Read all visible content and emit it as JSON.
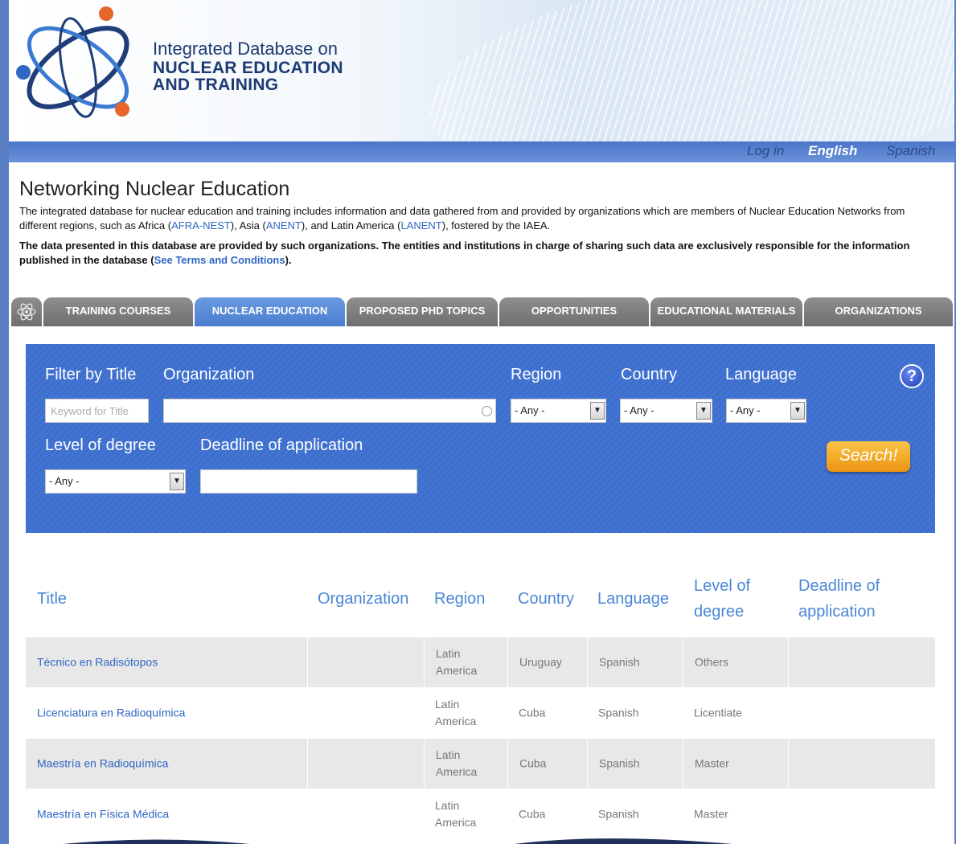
{
  "header": {
    "site_title_line1": "Integrated Database on",
    "site_title_line2": "NUCLEAR EDUCATION",
    "site_title_line3": "AND TRAINING"
  },
  "nav": {
    "login": "Log in",
    "english": "English",
    "spanish": "Spanish"
  },
  "intro": {
    "title": "Networking Nuclear Education",
    "p1_a": "The integrated database for nuclear education and training includes information and data gathered from and provided by organizations which are members of Nuclear Education Networks from different regions, such as Africa (",
    "afra": "AFRA-NEST",
    "p1_b": "), Asia (",
    "anent": "ANENT",
    "p1_c": "), and Latin America (",
    "lanent": "LANENT",
    "p1_d": "), fostered by the IAEA.",
    "p2_a": "The data presented in this database are provided by such organizations. The entities and institutions in charge of sharing such data are exclusively responsible for the information published in the database (",
    "terms": "See Terms and Conditions",
    "p2_b": ")."
  },
  "tabs": [
    {
      "label": "TRAINING COURSES"
    },
    {
      "label": "NUCLEAR EDUCATION"
    },
    {
      "label": "PROPOSED PHD TOPICS"
    },
    {
      "label": "OPPORTUNITIES"
    },
    {
      "label": "EDUCATIONAL MATERIALS"
    },
    {
      "label": "ORGANIZATIONS"
    }
  ],
  "filters": {
    "title_label": "Filter by Title",
    "title_placeholder": "Keyword for Title",
    "organization_label": "Organization",
    "region_label": "Region",
    "region_value": "- Any -",
    "country_label": "Country",
    "country_value": "- Any -",
    "language_label": "Language",
    "language_value": "- Any -",
    "degree_label": "Level of degree",
    "degree_value": "- Any -",
    "deadline_label": "Deadline of application",
    "help": "?",
    "search_label": "Search!"
  },
  "table": {
    "headers": {
      "title": "Title",
      "organization": "Organization",
      "region": "Region",
      "country": "Country",
      "language": "Language",
      "level_l1": "Level of",
      "level_l2": "degree",
      "deadline_l1": "Deadline of",
      "deadline_l2": "application"
    },
    "rows": [
      {
        "title": "Técnico en Radisótopos",
        "organization": "",
        "region_l1": "Latin",
        "region_l2": "America",
        "country": "Uruguay",
        "language": "Spanish",
        "level": "Others",
        "deadline": ""
      },
      {
        "title": "Licenciatura en Radioquímica",
        "organization": "",
        "region_l1": "Latin",
        "region_l2": "America",
        "country": "Cuba",
        "language": "Spanish",
        "level": "Licentiate",
        "deadline": ""
      },
      {
        "title": "Maestría en Radioquímica",
        "organization": "",
        "region_l1": "Latin",
        "region_l2": "America",
        "country": "Cuba",
        "language": "Spanish",
        "level": "Master",
        "deadline": ""
      },
      {
        "title": "Maestría en Física Médica",
        "organization": "",
        "region_l1": "Latin",
        "region_l2": "America",
        "country": "Cuba",
        "language": "Spanish",
        "level": "Master",
        "deadline": ""
      }
    ]
  },
  "colors": {
    "brand_blue": "#3d6fcf",
    "link_blue": "#2f67c3",
    "header_blue": "#4a86d6",
    "search_orange": "#f2a51c",
    "logo_orange": "#e8662a"
  }
}
